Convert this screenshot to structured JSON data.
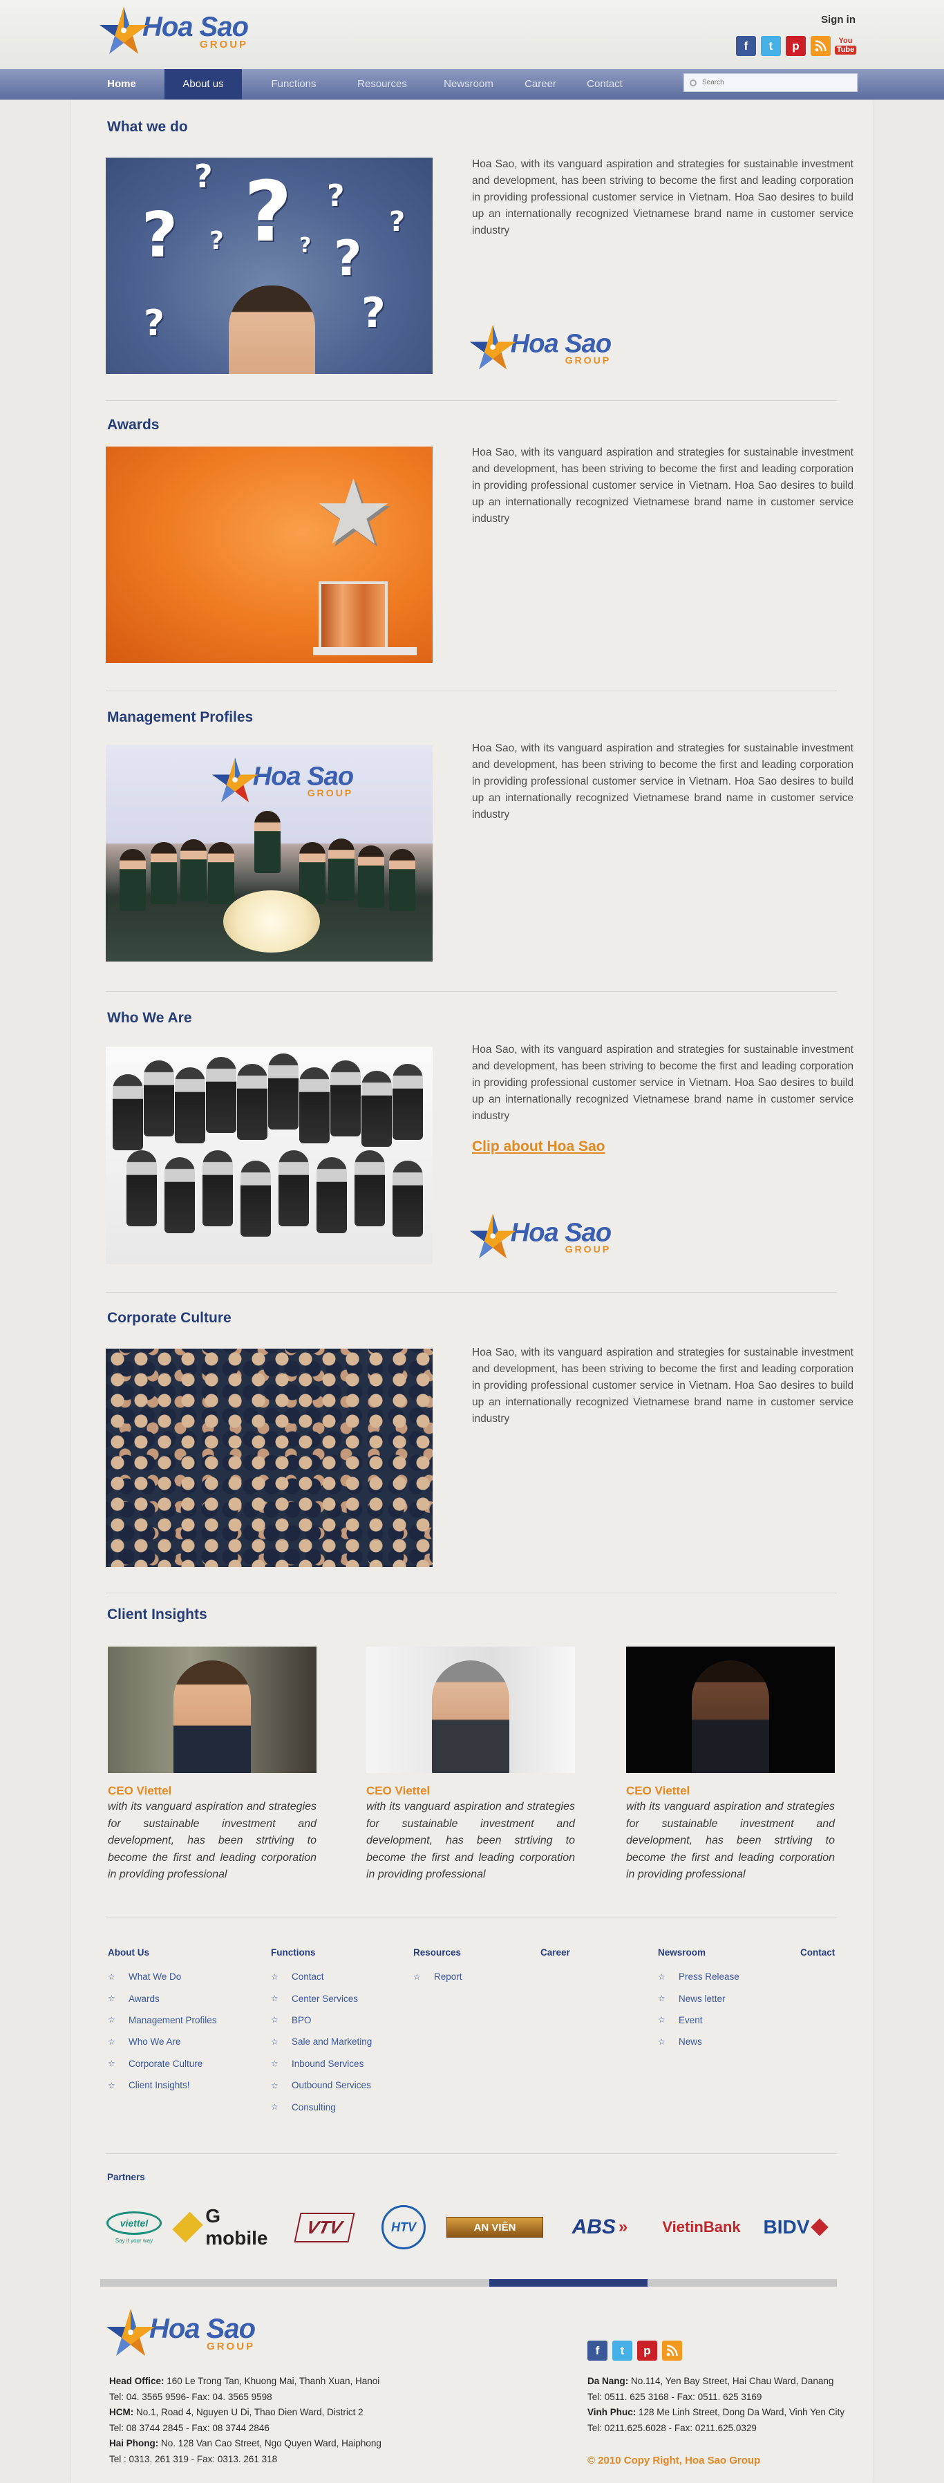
{
  "brand": {
    "name_top": "Hoa Sao",
    "name_bottom": "GROUP"
  },
  "header": {
    "sign_in": "Sign in",
    "social": [
      "facebook-icon",
      "twitter-icon",
      "pinterest-icon",
      "rss-icon",
      "youtube-icon"
    ]
  },
  "nav": {
    "items": [
      "Home",
      "About us",
      "Functions",
      "Resources",
      "Newsroom",
      "Career",
      "Contact"
    ],
    "active": "About us"
  },
  "search": {
    "placeholder": "Search"
  },
  "sections": [
    {
      "title": "What we do",
      "text": "Hoa Sao, with its vanguard aspiration and strategies for sustainable investment and development, has been striving to become the first and leading corporation in providing professional customer service in Vietnam. Hoa Sao desires to build up an internationally recognized Vietnamese brand name in customer service industry"
    },
    {
      "title": "Awards",
      "text": "Hoa Sao, with its vanguard aspiration and strategies for sustainable investment and development, has been striving to become the first and leading corporation in providing professional customer service in Vietnam. Hoa Sao desires to build up an internationally recognized Vietnamese brand name in customer service industry"
    },
    {
      "title": "Management Profiles",
      "text": "Hoa Sao, with its vanguard aspiration and strategies for sustainable investment and development, has been striving to become the first and leading corporation in providing professional customer service in Vietnam. Hoa Sao desires to build up an internationally recognized Vietnamese brand name in customer service industry"
    },
    {
      "title": "Who We Are",
      "text": "Hoa Sao, with its vanguard aspiration and strategies for sustainable investment and development, has been striving to become the first and leading corporation in providing professional customer service in Vietnam. Hoa Sao desires to build up an internationally recognized Vietnamese brand name in customer service industry",
      "link": "Clip about Hoa Sao"
    },
    {
      "title": "Corporate Culture",
      "text": "Hoa Sao, with its vanguard aspiration and strategies for sustainable investment and development, has been striving to become the first and leading corporation in providing professional customer service in Vietnam. Hoa Sao desires to build up an internationally recognized Vietnamese brand name in customer service industry"
    }
  ],
  "client_insights": {
    "title": "Client Insights",
    "cards": [
      {
        "role": "CEO Viettel",
        "quote": "with its vanguard aspiration and strategies for sustainable investment and development, has been strtiving to become the first and leading corporation in providing professional"
      },
      {
        "role": "CEO Viettel",
        "quote": "with its vanguard aspiration and strategies for sustainable investment and development, has been strtiving to become the first and leading corporation in providing professional"
      },
      {
        "role": "CEO Viettel",
        "quote": "with its vanguard aspiration and strategies for sustainable investment and development, has been strtiving to become the first and leading corporation in providing professional"
      }
    ]
  },
  "footer_links": {
    "about": {
      "title": "About Us",
      "items": [
        "What We Do",
        "Awards",
        "Management Profiles",
        "Who We Are",
        "Corporate Culture",
        "Client Insights!"
      ]
    },
    "functions": {
      "title": "Functions",
      "items": [
        "Contact",
        "Center Services",
        "BPO",
        "Sale and Marketing",
        "Inbound Services",
        "Outbound Services",
        "Consulting"
      ]
    },
    "resources": {
      "title": "Resources",
      "items": [
        "Report"
      ]
    },
    "career": {
      "title": "Career"
    },
    "newsroom": {
      "title": "Newsroom",
      "items": [
        "Press Release",
        "News letter",
        "Event",
        "News"
      ]
    },
    "contact": {
      "title": "Contact"
    }
  },
  "partners": {
    "title": "Partners",
    "items": [
      "viettel",
      "G mobile",
      "VTV",
      "HTV",
      "AN VIÊN",
      "ABS",
      "VietinBank",
      "BIDV"
    ],
    "viettel_tagline": "Say it your way",
    "colors": {
      "viettel": "#1b8f7a",
      "gmobile": "#222222",
      "vtv": "#8b1c2a",
      "htv": "#1f5fb0",
      "anvien": "#a66a1a",
      "abs": "#203e8a",
      "vietin": "#c3272e",
      "bidv": "#1c4a9a"
    }
  },
  "addresses": {
    "left": [
      {
        "label": "Head Office:",
        "value": " 160 Le Trong Tan,  Khuong Mai, Thanh Xuan, Hanoi"
      },
      {
        "label": "",
        "value": "Tel: 04. 3565 9596- Fax: 04. 3565 9598"
      },
      {
        "label": "HCM:",
        "value": " No.1, Road 4, Nguyen U Di, Thao Dien Ward, District 2"
      },
      {
        "label": "",
        "value": "Tel: 08 3744 2845 - Fax: 08 3744 2846"
      },
      {
        "label": "Hai Phong:",
        "value": " No. 128 Van Cao Street, Ngo Quyen Ward, Haiphong"
      },
      {
        "label": "",
        "value": "Tel : 0313. 261 319 - Fax: 0313. 261 318"
      }
    ],
    "right": [
      {
        "label": "Da Nang:",
        "value": " No.114, Yen Bay Street, Hai Chau Ward, Danang"
      },
      {
        "label": "",
        "value": "Tel: 0511. 625 3168 - Fax: 0511. 625 3169"
      },
      {
        "label": "Vinh Phuc:",
        "value": " 128 Me Linh Street, Dong Da Ward, Vinh Yen City"
      },
      {
        "label": "",
        "value": "Tel: 0211.625.6028 - Fax: 0211.625.0329"
      }
    ]
  },
  "copyright": "© 2010 Copy Right, Hoa Sao Group",
  "colors": {
    "accent": "#e8902a",
    "navy": "#253d78",
    "nav_active": "#2a3f7c"
  }
}
